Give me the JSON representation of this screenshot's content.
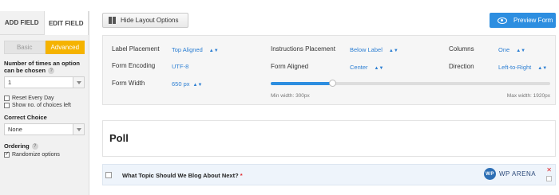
{
  "left_panel": {
    "tabs": {
      "add_field": "ADD FIELD",
      "edit_field": "EDIT FIELD"
    },
    "mode": {
      "basic": "Basic",
      "advanced": "Advanced"
    },
    "times_label_1": "Number of times an option",
    "times_label_2": "can be chosen",
    "help_glyph": "?",
    "times_value": "1",
    "reset_every_day": "Reset Every Day",
    "show_choices_left": "Show no. of choices left",
    "correct_choice_label": "Correct Choice",
    "correct_choice_value": "None",
    "ordering_label": "Ordering",
    "randomize_options": "Randomize options"
  },
  "toolbar": {
    "hide_layout": "Hide Layout Options",
    "preview_form": "Preview Form"
  },
  "settings": {
    "label_placement_label": "Label Placement",
    "label_placement_value": "Top Aligned",
    "instructions_placement_label": "Instructions Placement",
    "instructions_placement_value": "Below Label",
    "columns_label": "Columns",
    "columns_value": "One",
    "form_encoding_label": "Form Encoding",
    "form_encoding_value": "UTF-8",
    "form_aligned_label": "Form Aligned",
    "form_aligned_value": "Center",
    "direction_label": "Direction",
    "direction_value": "Left-to-Right",
    "form_width_label": "Form Width",
    "form_width_value": "650",
    "form_width_unit": "px",
    "slider_level": 0.22,
    "min_width": "Min width: 300px",
    "max_width": "Max width: 1920px",
    "updown_glyph": "▲▼"
  },
  "form": {
    "title": "Poll",
    "question": "What Topic Should We Blog About Next?",
    "required_marker": "*",
    "logo_text": "WP ARENA",
    "logo_initials": "WP",
    "close_glyph": "✕"
  },
  "colors": {
    "accent_blue": "#2d8ee0",
    "advanced_orange": "#f5b300",
    "required_red": "#e0262b"
  }
}
